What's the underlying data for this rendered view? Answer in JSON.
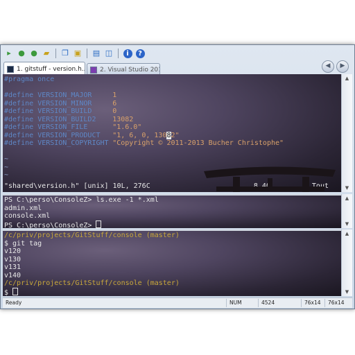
{
  "toolbar": {
    "icons": [
      "new-tab-icon",
      "play-icon",
      "play-all-icon",
      "open-folder-icon",
      "copy-icon",
      "paste-icon",
      "layout-icon",
      "split-icon",
      "info-icon",
      "help-icon"
    ]
  },
  "tabs": [
    {
      "label": "1. gitstuff - version.h..."
    },
    {
      "label": "2. Visual Studio 2010"
    }
  ],
  "vim": {
    "lines": [
      {
        "kw": "#pragma once",
        "name": "",
        "value": ""
      },
      {
        "kw": "",
        "name": "",
        "value": ""
      },
      {
        "kw": "#define",
        "name": "VERSION_MAJOR",
        "value": "1"
      },
      {
        "kw": "#define",
        "name": "VERSION_MINOR",
        "value": "6"
      },
      {
        "kw": "#define",
        "name": "VERSION_BUILD",
        "value": "0"
      },
      {
        "kw": "#define",
        "name": "VERSION_BUILD2",
        "value": "13082"
      },
      {
        "kw": "#define",
        "name": "VERSION_FILE",
        "value": "\"1.6.0\""
      },
      {
        "kw": "#define",
        "name": "VERSION_PRODUCT",
        "value_pre": "\"1, 6, 0, 130",
        "value_cursor": "8",
        "value_post": "2\""
      },
      {
        "kw": "#define",
        "name": "VERSION_COPYRIGHT",
        "value": "\"Copyright © 2011-2013 Bucher Christophe\""
      }
    ],
    "tildes": [
      "~",
      "~",
      "~"
    ],
    "status_file": "\"shared\\version.h\" [unix] 10L, 276C",
    "status_pos": "8,40",
    "status_scroll": "Tout"
  },
  "powershell": {
    "prompt": "PS C:\\perso\\ConsoleZ>",
    "command": "ls.exe -1 *.xml",
    "output": [
      "admin.xml",
      "console.xml"
    ],
    "prompt2": "PS C:\\perso\\ConsoleZ>"
  },
  "git": {
    "path1": "/c/priv/projects/GitStuff/console (master)",
    "command": "$ git tag",
    "tags": [
      "v120",
      "v130",
      "v131",
      "v140"
    ],
    "path2": "/c/priv/projects/GitStuff/console (master)",
    "prompt": "$"
  },
  "statusbar": {
    "ready": "Ready",
    "num": "NUM",
    "pid": "4524",
    "size1": "76x14",
    "size2": "76x14"
  }
}
